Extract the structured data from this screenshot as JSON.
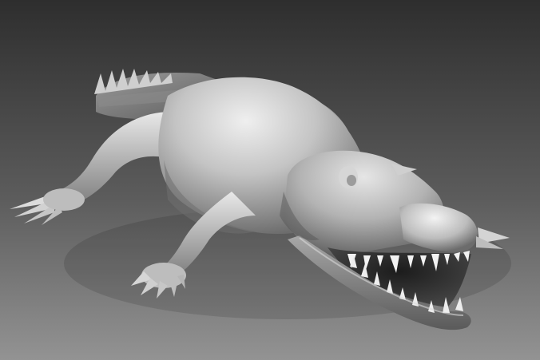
{
  "scene": {
    "subject": "3d-sculpt-render",
    "colors": {
      "background_top": "#2e2e2e",
      "background_bottom": "#8f8f8f",
      "clay_light": "#ededed",
      "clay_mid": "#b9b9b9",
      "clay_dark": "#5a5a5a",
      "mouth_dark": "#2b2b2b",
      "teeth": "#f2f2f2"
    }
  }
}
